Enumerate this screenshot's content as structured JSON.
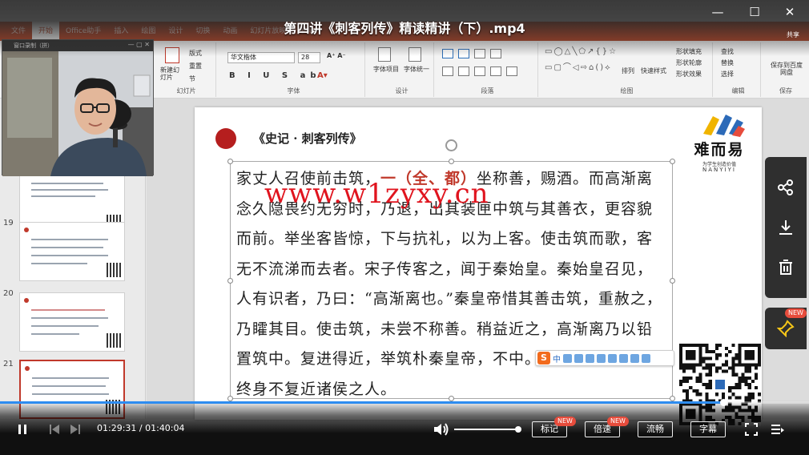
{
  "video": {
    "title": "第四讲《刺客列传》精读精讲（下）.mp4",
    "current_time": "01:29:31",
    "total_time": "01:40:04",
    "progress_fraction": 0.894,
    "volume_fraction": 1.0
  },
  "ppt": {
    "tabs": [
      "文件",
      "开始",
      "Office助手",
      "插入",
      "绘图",
      "设计",
      "切换",
      "动画",
      "幻灯片放映",
      "审阅"
    ],
    "active_tab": "开始",
    "share_label": "共享",
    "ribbon_groups": {
      "slides": {
        "label": "幻灯片",
        "new_slide": "新建幻灯片",
        "layout": "版式",
        "reset": "重置",
        "section": "节"
      },
      "font": {
        "label": "字体",
        "font_name": "华文楷体",
        "font_size": "28"
      },
      "paragraph": {
        "label": "段落"
      },
      "design": {
        "label": "设计",
        "font_items": "字体项目",
        "font_other": "字体统一"
      },
      "drawing": {
        "label": "绘图",
        "arrange": "排列",
        "quick_styles": "快速样式",
        "shape_fill": "形状填充",
        "shape_outline": "形状轮廓",
        "shape_effects": "形状效果"
      },
      "editing": {
        "label": "编辑",
        "find": "查找",
        "replace": "替换",
        "select": "选择"
      },
      "save": {
        "label": "保存",
        "save_to": "保存到百度网盘"
      }
    },
    "webcam_window_title": "窗口录制（拼）",
    "slides_panel": [
      {
        "number": "19"
      },
      {
        "number": "20"
      },
      {
        "number": "21"
      }
    ]
  },
  "slide": {
    "heading": "《史记 · 刺客列传》",
    "brand_name": "难而易",
    "brand_subtitle": "为学生创造价值",
    "brand_en": "NANYIYI",
    "watermark": "www.w1zyxy.cn",
    "text_lines": [
      {
        "pre": "家丈人召使前击筑，",
        "hl": "一（全、都）",
        "post": "坐称善，赐酒。而高渐离"
      },
      {
        "pre": "念久隐畏约无穷时，乃退，出其装匣中筑与其善衣，更容貌",
        "hl": "",
        "post": ""
      },
      {
        "pre": "而前。举坐客皆惊，下与抗礼，以为上客。使击筑而歌，客",
        "hl": "",
        "post": ""
      },
      {
        "pre": "无不流涕而去者。宋子传客之，闻于秦始皇。秦始皇召见，",
        "hl": "",
        "post": ""
      },
      {
        "pre": "人有识者，乃曰：“高渐离也。”秦皇帝惜其善击筑，重赦之，",
        "hl": "",
        "post": ""
      },
      {
        "pre": "乃矐其目。使击筑，未尝不称善。稍益近之，高渐离乃以铅",
        "hl": "",
        "post": ""
      },
      {
        "pre": "置筑中。复进得近，举筑朴秦皇帝，不中。于是遂诛高渐离，",
        "hl": "",
        "post": ""
      },
      {
        "pre": "终身不复近诸侯之人。",
        "hl": "",
        "post": ""
      }
    ]
  },
  "ime": {
    "logo": "S",
    "mode": "中"
  },
  "side_panel": {
    "new_badge": "NEW"
  },
  "controls": {
    "mark_label": "标记",
    "speed_label": "倍速",
    "quality_label": "流畅",
    "subtitle_label": "字幕",
    "new_badge": "NEW"
  },
  "colors": {
    "accent": "#2d8cf0",
    "ppt_red": "#b7472a",
    "highlight_red": "#c0392b",
    "watermark_red": "#e0141e"
  }
}
